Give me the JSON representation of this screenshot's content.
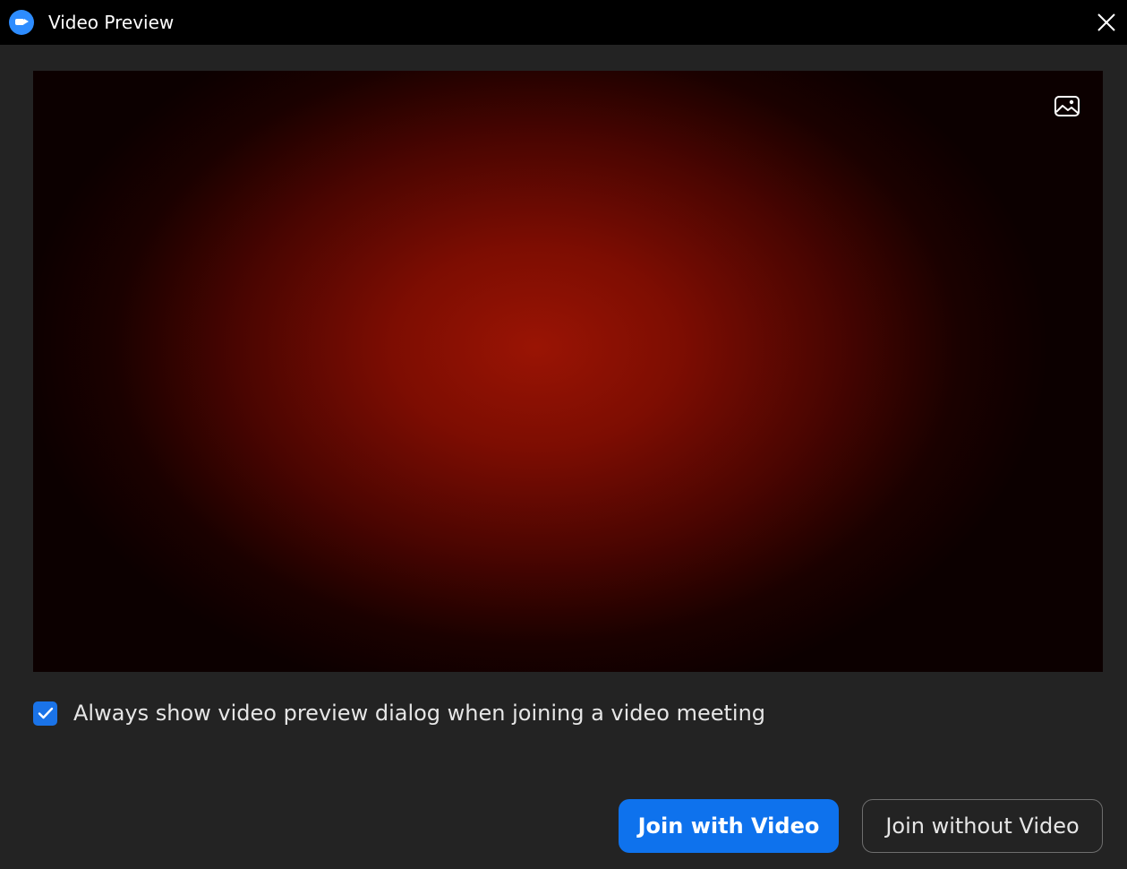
{
  "window": {
    "title": "Video Preview",
    "app_icon": "zoom-logo-icon",
    "close_icon": "close-icon"
  },
  "preview": {
    "background_icon": "image-background-icon"
  },
  "options": {
    "always_show_label": "Always show video preview dialog when joining a video meeting",
    "always_show_checked": true
  },
  "actions": {
    "join_with_video_label": "Join with Video",
    "join_without_video_label": "Join without Video"
  },
  "colors": {
    "titlebar": "#000000",
    "dialog_background": "#232323",
    "accent_blue": "#0e72ed",
    "checkbox_blue": "#1a73e8",
    "preview_red": "#9a1404"
  }
}
